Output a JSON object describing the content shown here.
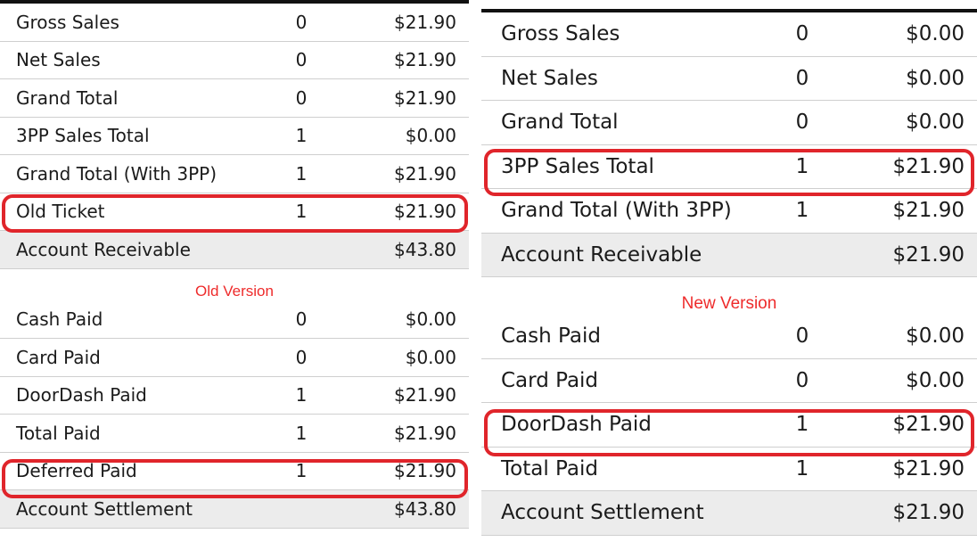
{
  "old_version": {
    "label": "Old Version",
    "sales": [
      {
        "label": "Gross Sales",
        "count": "0",
        "amount": "$21.90"
      },
      {
        "label": "Net Sales",
        "count": "0",
        "amount": "$21.90"
      },
      {
        "label": "Grand Total",
        "count": "0",
        "amount": "$21.90"
      },
      {
        "label": "3PP Sales Total",
        "count": "1",
        "amount": "$0.00"
      },
      {
        "label": "Grand Total (With 3PP)",
        "count": "1",
        "amount": "$21.90"
      },
      {
        "label": "Old Ticket",
        "count": "1",
        "amount": "$21.90"
      }
    ],
    "sales_total": {
      "label": "Account Receivable",
      "amount": "$43.80"
    },
    "payments": [
      {
        "label": "Cash Paid",
        "count": "0",
        "amount": "$0.00"
      },
      {
        "label": "Card Paid",
        "count": "0",
        "amount": "$0.00"
      },
      {
        "label": "DoorDash Paid",
        "count": "1",
        "amount": "$21.90"
      },
      {
        "label": "Total Paid",
        "count": "1",
        "amount": "$21.90"
      },
      {
        "label": "Deferred Paid",
        "count": "1",
        "amount": "$21.90"
      }
    ],
    "payments_total": {
      "label": "Account Settlement",
      "amount": "$43.80"
    }
  },
  "new_version": {
    "label": "New Version",
    "sales": [
      {
        "label": "Gross Sales",
        "count": "0",
        "amount": "$0.00"
      },
      {
        "label": "Net Sales",
        "count": "0",
        "amount": "$0.00"
      },
      {
        "label": "Grand Total",
        "count": "0",
        "amount": "$0.00"
      },
      {
        "label": "3PP Sales Total",
        "count": "1",
        "amount": "$21.90"
      },
      {
        "label": "Grand Total (With 3PP)",
        "count": "1",
        "amount": "$21.90"
      }
    ],
    "sales_total": {
      "label": "Account Receivable",
      "amount": "$21.90"
    },
    "payments": [
      {
        "label": "Cash Paid",
        "count": "0",
        "amount": "$0.00"
      },
      {
        "label": "Card Paid",
        "count": "0",
        "amount": "$0.00"
      },
      {
        "label": "DoorDash Paid",
        "count": "1",
        "amount": "$21.90"
      },
      {
        "label": "Total Paid",
        "count": "1",
        "amount": "$21.90"
      }
    ],
    "payments_total": {
      "label": "Account Settlement",
      "amount": "$21.90"
    }
  },
  "colors": {
    "highlight": "#e0252b",
    "version_label": "#ee2b2b",
    "total_row_bg": "#ececec"
  }
}
